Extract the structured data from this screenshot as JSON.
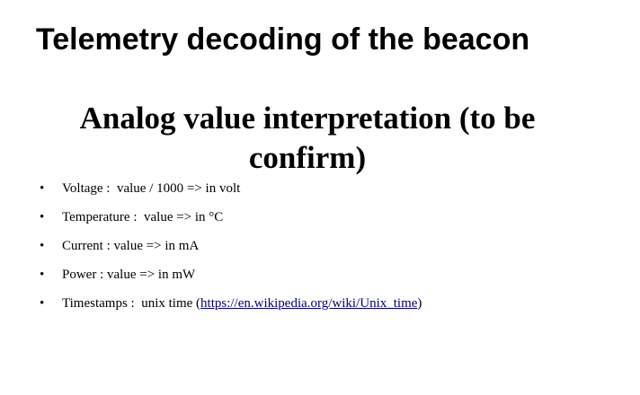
{
  "slide": {
    "title": "Telemetry decoding of the beacon",
    "heading": "Analog value interpretation (to be confirm)",
    "bullet_symbol": "•",
    "bullets": [
      {
        "text": "Voltage :  value / 1000 => in volt"
      },
      {
        "text": "Temperature :  value => in °C"
      },
      {
        "text": "Current : value => in mA"
      },
      {
        "text": "Power : value => in mW"
      },
      {
        "text_before": "Timestamps :  unix time (",
        "link_text": "https://en.wikipedia.org/wiki/Unix_time",
        "text_after": ")"
      }
    ],
    "colors": {
      "text": "#000000",
      "link": "#000080",
      "background": "#ffffff"
    }
  }
}
